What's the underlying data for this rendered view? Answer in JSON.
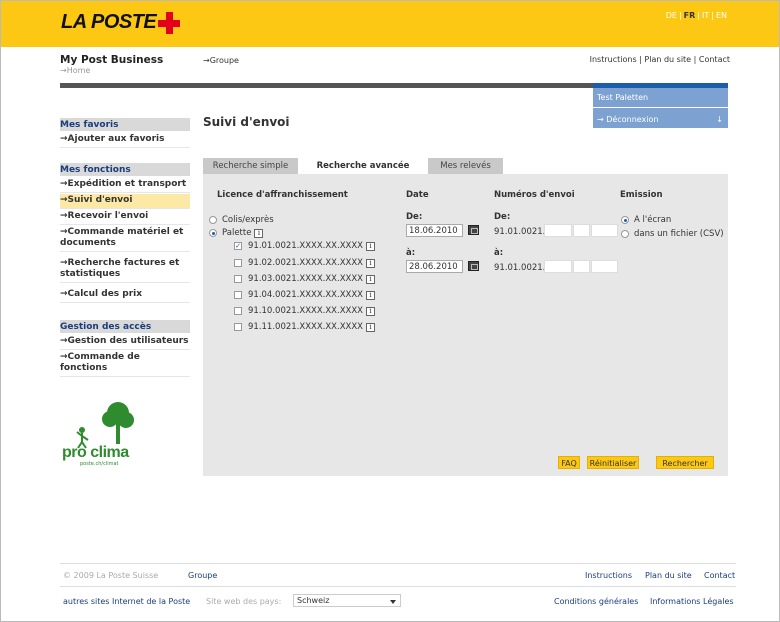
{
  "header": {
    "logo_text": "LA POSTE",
    "languages": [
      "DE",
      "FR",
      "IT",
      "EN"
    ],
    "active_language": "FR"
  },
  "brand": "My Post Business",
  "breadcrumb": "→Home",
  "top_group_link": "→Groupe",
  "top_links": {
    "instructions": "Instructions",
    "sitemap": "Plan du site",
    "contact": "Contact"
  },
  "user_panel": {
    "user": "Test Paletten",
    "logout": "→ Déconnexion",
    "arrow": "↓"
  },
  "sidebar": {
    "favorites_head": "Mes favoris",
    "add_favorite": "→Ajouter aux favoris",
    "functions_head": "Mes fonctions",
    "functions": [
      "→Expédition et transport",
      "→Suivi d'envoi",
      "→Recevoir l'envoi",
      "→Commande matériel et documents",
      "→Recherche factures et statistiques",
      "→Calcul des prix"
    ],
    "access_head": "Gestion des accès",
    "access": [
      "→Gestion des utilisateurs",
      "→Commande de fonctions"
    ]
  },
  "proclima": {
    "text": "pro clima",
    "sub": "poste.ch/climat"
  },
  "page_title": "Suivi d'envoi",
  "tabs": [
    "Recherche simple",
    "Recherche avancée",
    "Mes relevés"
  ],
  "active_tab": "Recherche avancée",
  "form": {
    "licence_head": "Licence d'affranchissement",
    "date_head": "Date",
    "numbers_head": "Numéros d'envoi",
    "emission_head": "Emission",
    "radio_colis": "Colis/exprès",
    "radio_palette": "Palette",
    "info_icon": "i",
    "licences": [
      {
        "label": "91.01.0021.XXXX.XX.XXXX",
        "checked": true
      },
      {
        "label": "91.02.0021.XXXX.XX.XXXX",
        "checked": false
      },
      {
        "label": "91.03.0021.XXXX.XX.XXXX",
        "checked": false
      },
      {
        "label": "91.04.0021.XXXX.XX.XXXX",
        "checked": false
      },
      {
        "label": "91.10.0021.XXXX.XX.XXXX",
        "checked": false
      },
      {
        "label": "91.11.0021.XXXX.XX.XXXX",
        "checked": false
      }
    ],
    "date_from_label": "De:",
    "date_from": "18.06.2010",
    "date_to_label": "à:",
    "date_to": "28.06.2010",
    "num_from_label": "De:",
    "num_to_label": "à:",
    "num_prefix": "91.01.0021.",
    "emission_screen": "A l'écran",
    "emission_file": "dans un fichier (CSV)",
    "buttons": {
      "faq": "FAQ",
      "reset": "Réinitialiser",
      "search": "Rechercher"
    }
  },
  "footer": {
    "copyright": "© 2009 La Poste Suisse",
    "group": "Groupe",
    "instructions": "Instructions",
    "sitemap": "Plan du site",
    "contact": "Contact",
    "other_sites": "autres sites Internet de la Poste",
    "country_label": "Site web des pays:",
    "country_value": "Schweiz",
    "conditions": "Conditions générales",
    "legal": "Informations Légales"
  },
  "colors": {
    "yellow": "#fdc814",
    "red": "#e2001a",
    "blue": "#1a5da8",
    "green": "#2e8b2e"
  }
}
